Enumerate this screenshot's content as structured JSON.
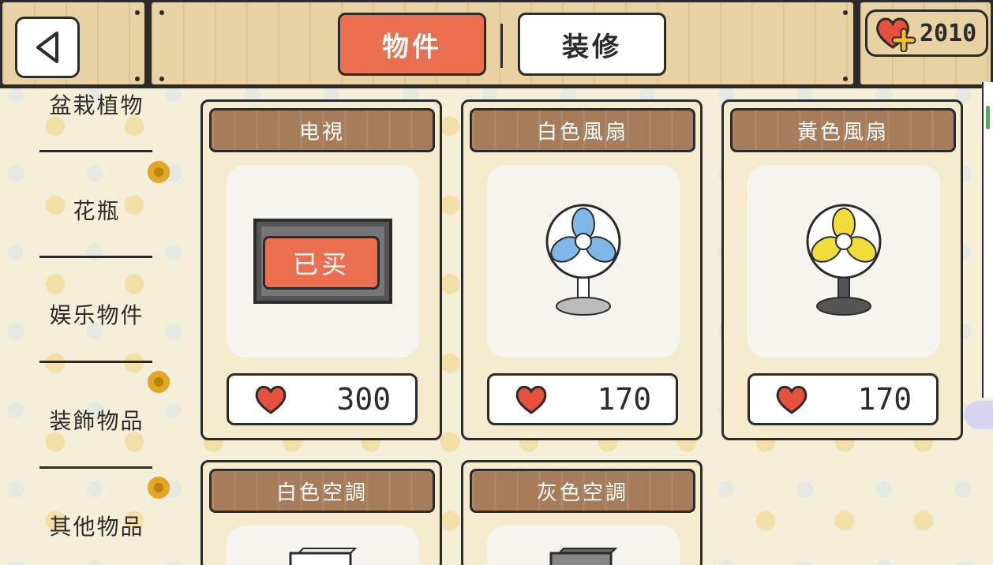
{
  "header": {
    "back_icon": "back-triangle-icon",
    "tabs": [
      {
        "label": "物件",
        "active": true
      },
      {
        "label": "装修",
        "active": false
      }
    ],
    "currency": {
      "icon": "heart-plus-icon",
      "value": "2010"
    }
  },
  "sidebar": {
    "categories": [
      {
        "label": "盆栽植物",
        "badge": false
      },
      {
        "label": "花瓶",
        "badge": true
      },
      {
        "label": "娱乐物件",
        "badge": false
      },
      {
        "label": "装飾物品",
        "badge": true
      },
      {
        "label": "其他物品",
        "badge": true
      }
    ]
  },
  "items": [
    {
      "name": "电視",
      "price": "300",
      "bought": true,
      "bought_label": "已买",
      "icon": "tv-icon"
    },
    {
      "name": "白色風扇",
      "price": "170",
      "bought": false,
      "icon": "white-fan-icon",
      "blade_color": "#7fb8e6"
    },
    {
      "name": "黃色風扇",
      "price": "170",
      "bought": false,
      "icon": "yellow-fan-icon",
      "blade_color": "#f0dc3a"
    },
    {
      "name": "白色空調",
      "icon": "white-ac-icon"
    },
    {
      "name": "灰色空調",
      "icon": "gray-ac-icon"
    }
  ],
  "colors": {
    "accent": "#ea6e50",
    "wood": "#a67c5b",
    "heart": "#e5513d"
  }
}
